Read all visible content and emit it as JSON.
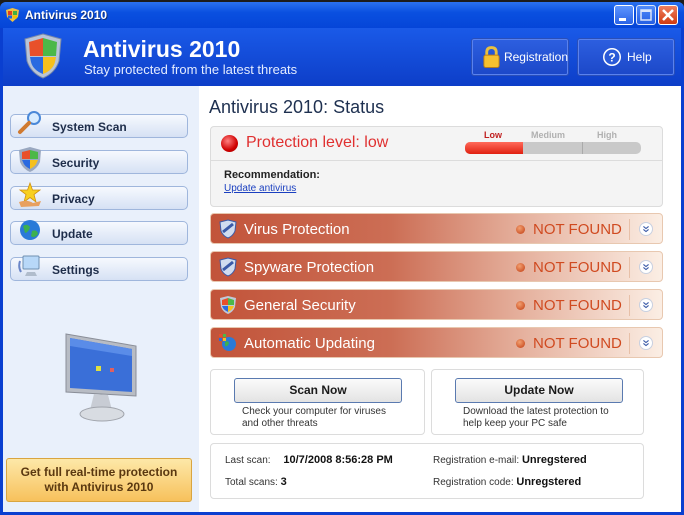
{
  "window": {
    "title": "Antivirus 2010"
  },
  "header": {
    "title": "Antivirus 2010",
    "subtitle": "Stay protected from the latest threats",
    "buttons": [
      {
        "label": "Registration",
        "icon": "padlock-icon"
      },
      {
        "label": "Help",
        "icon": "help-icon"
      }
    ]
  },
  "sidebar": {
    "items": [
      {
        "label": "System Scan",
        "icon": "magnifier-icon"
      },
      {
        "label": "Security",
        "icon": "shield-icon"
      },
      {
        "label": "Privacy",
        "icon": "star-hand-icon"
      },
      {
        "label": "Update",
        "icon": "globe-icon"
      },
      {
        "label": "Settings",
        "icon": "computer-settings-icon"
      }
    ],
    "promo": {
      "line1": "Get full real-time protection",
      "line2": "with Antivirus 2010"
    }
  },
  "main": {
    "title": "Antivirus 2010: Status",
    "protection": {
      "label": "Protection level: low",
      "levels": [
        "Low",
        "Medium",
        "High"
      ],
      "current_level": "Low",
      "meter_fraction": 0.33
    },
    "recommendation": {
      "label": "Recommendation:",
      "link": "Update antivirus"
    },
    "components": [
      {
        "label": "Virus Protection",
        "status": "NOT FOUND",
        "icon": "shield-icon"
      },
      {
        "label": "Spyware Protection",
        "status": "NOT FOUND",
        "icon": "shield-icon"
      },
      {
        "label": "General Security",
        "status": "NOT FOUND",
        "icon": "windows-shield-icon"
      },
      {
        "label": "Automatic Updating",
        "status": "NOT FOUND",
        "icon": "windows-update-icon"
      }
    ],
    "actions": [
      {
        "button": "Scan Now",
        "desc_line1": "Check your computer for viruses",
        "desc_line2": "and other threats"
      },
      {
        "button": "Update Now",
        "desc_line1": "Download the latest protection to",
        "desc_line2": "help keep your PC safe"
      }
    ],
    "info": {
      "last_scan_label": "Last scan:",
      "last_scan_value": "10/7/2008 8:56:28 PM",
      "total_scans_label": "Total scans:",
      "total_scans_value": "3",
      "reg_email_label": "Registration e-mail:",
      "reg_email_value": "Unregstered",
      "reg_code_label": "Registration code:",
      "reg_code_value": "Unregstered"
    }
  }
}
